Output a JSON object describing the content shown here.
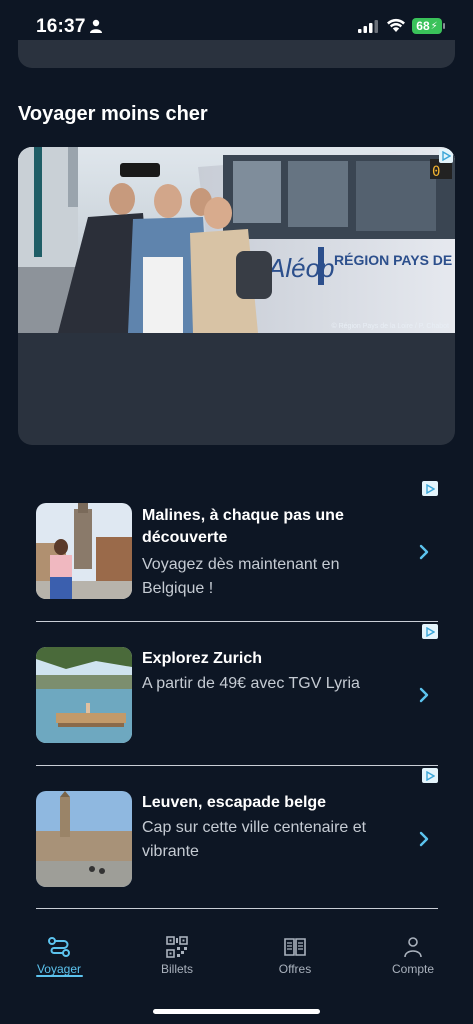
{
  "status_bar": {
    "time": "16:37",
    "battery": "68"
  },
  "section": {
    "title": "Voyager moins cher"
  },
  "ad_banner": {
    "credit": "© Région Pays de la Loire / P. Chabot",
    "train_brand": "Aléop",
    "train_region": "RÉGION PAYS DE LA LOIRE",
    "train_number": "0"
  },
  "list": [
    {
      "title": "Malines, à chaque pas une découverte",
      "subtitle": "Voyagez dès maintenant en Belgique !"
    },
    {
      "title": "Explorez Zurich",
      "subtitle": "A partir de 49€ avec TGV Lyria"
    },
    {
      "title": "Leuven, escapade belge",
      "subtitle": "Cap sur cette ville centenaire et vibrante"
    }
  ],
  "tabs": [
    {
      "label": "Voyager",
      "icon": "route-icon",
      "active": true
    },
    {
      "label": "Billets",
      "icon": "qr-code-icon",
      "active": false
    },
    {
      "label": "Offres",
      "icon": "book-open-icon",
      "active": false
    },
    {
      "label": "Compte",
      "icon": "person-icon",
      "active": false
    }
  ],
  "colors": {
    "background": "#0d1624",
    "card": "#2a323e",
    "accent": "#5cc3ee",
    "battery": "#3ac25a"
  }
}
